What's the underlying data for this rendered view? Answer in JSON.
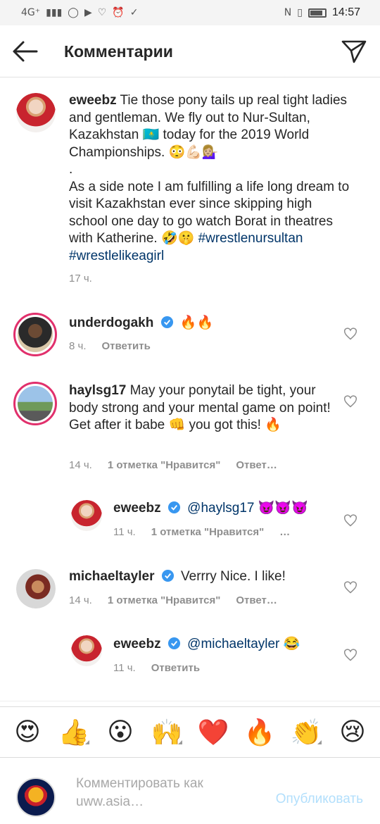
{
  "status_bar": {
    "network": "4G⁺",
    "icons": [
      "signal-icon",
      "wifi-icon",
      "whatsapp-icon",
      "youtube-icon",
      "heartbeat-icon",
      "alarm-icon",
      "check-icon",
      "nfc-icon",
      "vibrate-icon",
      "battery-icon"
    ],
    "battery_level": 0.85,
    "time": "14:57"
  },
  "header": {
    "title": "Комментарии"
  },
  "caption": {
    "username": "eweebz",
    "text_line1": " Tie those pony tails up real tight ladies and gentleman. We fly out to Nur-Sultan, Kazakhstan 🇰🇿 today for the 2019 World Championships. 😳💪🏻💁🏼‍♀️",
    "dot": ".",
    "text_line2": "As a side note I am fulfilling a life long dream to visit Kazakhstan ever since skipping high school one day to go watch Borat in theatres with Katherine. 🤣🤫",
    "hashtag1": "#wrestlenursultan",
    "hashtag2": "#wrestlelikeagirl",
    "time": "17 ч."
  },
  "comments": [
    {
      "username": "underdogakh",
      "verified": true,
      "text": "🔥🔥",
      "time": "8 ч.",
      "likes": "",
      "reply": "Ответить"
    },
    {
      "username": "haylsg17",
      "verified": false,
      "text": " May your ponytail be tight, your body strong and your mental game on point! Get after it babe 👊 you got this! 🔥",
      "time": "14 ч.",
      "likes": "1 отметка \"Нравится\"",
      "reply": "Ответ…"
    },
    {
      "username": "eweebz",
      "verified": true,
      "mention": "@haylsg17",
      "text": " 😈😈😈",
      "time": "11 ч.",
      "likes": "1 отметка \"Нравится\"",
      "reply": "…"
    },
    {
      "username": "michaeltayler",
      "verified": true,
      "text": "Verrry Nice. I like!",
      "time": "14 ч.",
      "likes": "1 отметка \"Нравится\"",
      "reply": "Ответ…"
    },
    {
      "username": "eweebz",
      "verified": true,
      "mention": "@michaeltayler",
      "text": " 😂",
      "time": "11 ч.",
      "likes": "",
      "reply": "Ответить"
    }
  ],
  "emoji_bar": [
    "😍",
    "👍",
    "😮",
    "🙌",
    "❤️",
    "🔥",
    "👏",
    "😢"
  ],
  "composer": {
    "placeholder": "Комментировать как uww.asia…",
    "publish_label": "Опубликовать"
  },
  "colors": {
    "accent_link": "#003569",
    "publish_disabled": "#b2dffc",
    "verified_blue": "#3897f0",
    "story_ring": "#e1306c"
  }
}
